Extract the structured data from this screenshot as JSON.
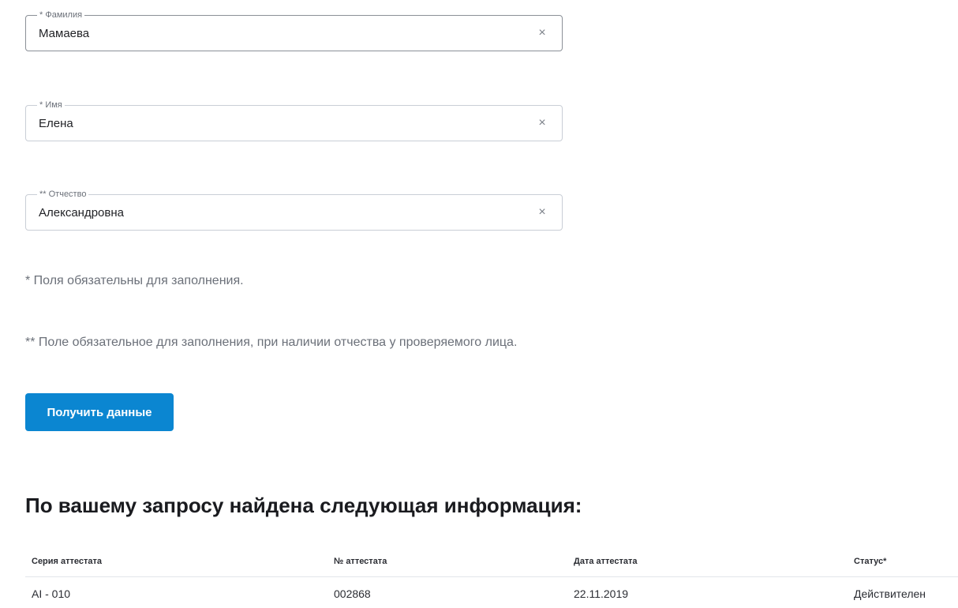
{
  "form": {
    "fields": [
      {
        "label": "* Фамилия",
        "value": "Мамаева"
      },
      {
        "label": "* Имя",
        "value": "Елена"
      },
      {
        "label": "** Отчество",
        "value": "Александровна"
      }
    ],
    "clear_symbol": "×",
    "note_required": "* Поля обязательны для заполнения.",
    "note_patronymic": "** Поле обязательное для заполнения, при наличии отчества у проверяемого лица.",
    "submit_label": "Получить данные"
  },
  "result": {
    "heading": "По вашему запросу найдена следующая информация:",
    "columns": [
      "Серия аттестата",
      "№ аттестата",
      "Дата аттестата",
      "Статус*"
    ],
    "rows": [
      [
        "AI - 010",
        "002868",
        "22.11.2019",
        "Действителен"
      ]
    ]
  }
}
